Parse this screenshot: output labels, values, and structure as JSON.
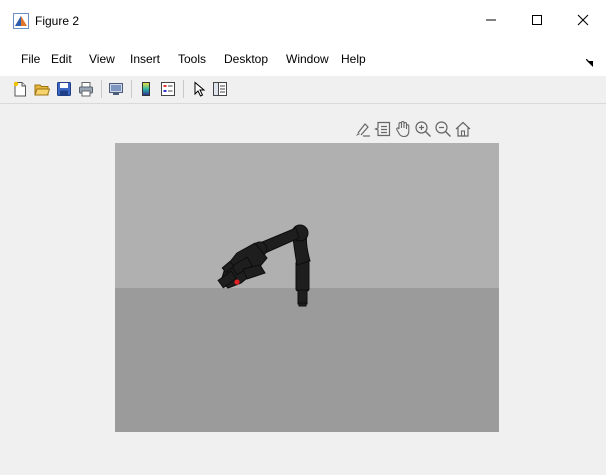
{
  "window": {
    "title": "Figure 2",
    "icons": {
      "app": "matlab-figure-icon",
      "minimize": "minimize-icon",
      "maximize": "maximize-icon",
      "close": "close-icon"
    }
  },
  "menu": {
    "items": [
      {
        "label": "File"
      },
      {
        "label": "Edit"
      },
      {
        "label": "View"
      },
      {
        "label": "Insert"
      },
      {
        "label": "Tools"
      },
      {
        "label": "Desktop"
      },
      {
        "label": "Window"
      },
      {
        "label": "Help"
      }
    ]
  },
  "toolbar": {
    "buttons": [
      {
        "icon": "new-figure-icon"
      },
      {
        "icon": "open-file-icon"
      },
      {
        "icon": "save-figure-icon"
      },
      {
        "icon": "print-figure-icon"
      },
      {
        "icon": "link-plot-icon"
      },
      {
        "icon": "insert-colorbar-icon"
      },
      {
        "icon": "insert-legend-icon"
      },
      {
        "icon": "edit-plot-icon"
      },
      {
        "icon": "property-inspector-icon"
      }
    ]
  },
  "axes_toolbar": {
    "buttons": [
      {
        "icon": "brush-icon"
      },
      {
        "icon": "data-tips-icon"
      },
      {
        "icon": "pan-hand-icon"
      },
      {
        "icon": "zoom-in-icon"
      },
      {
        "icon": "zoom-out-icon"
      },
      {
        "icon": "restore-view-icon"
      }
    ]
  },
  "scene": {
    "sky_color": "#b0b0b0",
    "floor_color": "#9b9b9b",
    "robot_color": "#1e1e1e",
    "marker_color": "#e02020"
  }
}
